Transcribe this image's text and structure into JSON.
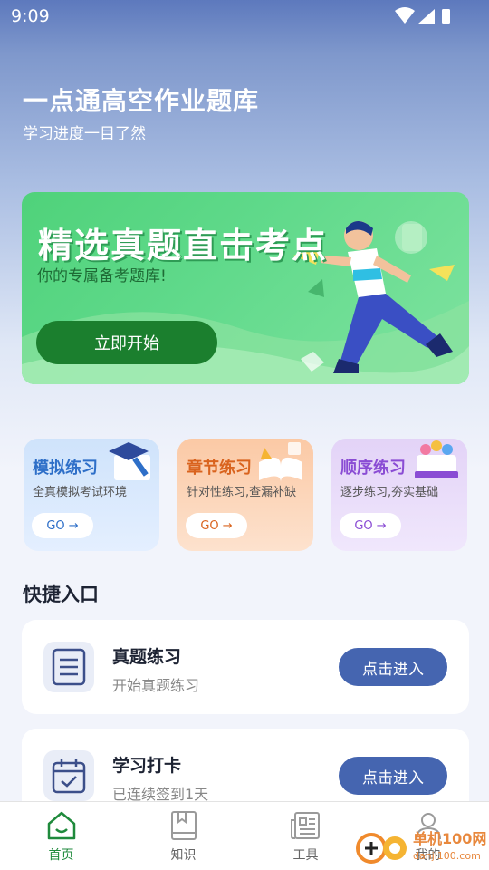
{
  "status_bar": {
    "time": "9:09"
  },
  "hero": {
    "title": "一点通高空作业题库",
    "subtitle": "学习进度一目了然"
  },
  "banner": {
    "headline": "精选真题直击考点",
    "tagline": "你的专属备考题库!",
    "button": "立即开始"
  },
  "modes": [
    {
      "title": "模拟练习",
      "desc": "全真模拟考试环境",
      "go": "GO →"
    },
    {
      "title": "章节练习",
      "desc": "针对性练习,查漏补缺",
      "go": "GO →"
    },
    {
      "title": "顺序练习",
      "desc": "逐步练习,夯实基础",
      "go": "GO →"
    }
  ],
  "quick_entry": {
    "title": "快捷入口",
    "items": [
      {
        "title": "真题练习",
        "subtitle": "开始真题练习",
        "button": "点击进入"
      },
      {
        "title": "学习打卡",
        "subtitle": "已连续签到1天",
        "button": "点击进入"
      }
    ]
  },
  "tabs": [
    {
      "label": "首页",
      "icon": "home-icon",
      "active": true
    },
    {
      "label": "知识",
      "icon": "book-icon"
    },
    {
      "label": "工具",
      "icon": "news-icon"
    },
    {
      "label": "我的",
      "icon": "user-icon"
    }
  ],
  "watermark": {
    "line1": "单机100网",
    "line2": "danji100.com"
  },
  "colors": {
    "accent": "#4565b0",
    "banner_green": "#4fd27a",
    "active_tab": "#1f8a3c"
  }
}
